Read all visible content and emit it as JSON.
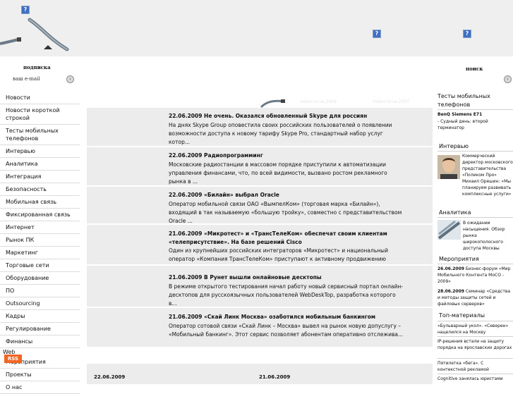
{
  "header": {
    "subscribe_title": "подписка",
    "email_placeholder": "ваш e-mail",
    "search_title": "поиск"
  },
  "nav": {
    "items": [
      {
        "label": "Новости"
      },
      {
        "label": "Новости короткой строкой"
      },
      {
        "label": "Тесты мобильных телефонов"
      },
      {
        "label": "Интервью"
      },
      {
        "label": "Аналитика"
      },
      {
        "label": "Интеграция"
      },
      {
        "label": "Безопасность"
      },
      {
        "label": "Мобильная связь"
      },
      {
        "label": "Фиксированная связь"
      },
      {
        "label": "Интернет"
      },
      {
        "label": "Рынок ПК"
      },
      {
        "label": "Маркетинг"
      },
      {
        "label": "Торговые сети"
      },
      {
        "label": "Оборудование"
      },
      {
        "label": "ПО"
      },
      {
        "label": "Outsourcing"
      },
      {
        "label": "Кадры"
      },
      {
        "label": "Регулирование"
      },
      {
        "label": "Финансы"
      }
    ],
    "web_label": "Web",
    "items2": [
      {
        "label": "Мероприятия"
      },
      {
        "label": "Проекты"
      },
      {
        "label": "О нас"
      }
    ],
    "rss_label": "RSS"
  },
  "news": [
    {
      "title": "22.06.2009 Не очень. Оказался обновленный Skype для россиян",
      "text": "На днях Skype Group оповестила своих российских пользователей о появлении возможности доступа к новому тарифу Skype Pro, стандартный набор услуг котор..."
    },
    {
      "title": "22.06.2009 Радиопрограмминг",
      "text": "Московские радиостанции в массовом порядке приступили к автоматизации управления финансами, что, по всей видимости, вызвано ростом рекламного рынка в ..."
    },
    {
      "title": "22.06.2009 «Билайн» выбрал Oracle",
      "text": "Оператор мобильной связи ОАО «ВымпелКом» (торговая марка «Билайн»), входящий в так называемую «большую тройку», совместно с представительством Oracle ..."
    },
    {
      "title": "21.06.2009 «Микротест» и «ТрансТелеКом» обеспечат своим клиентам «телеприсутствие». На базе решений Cisco",
      "text": "Один из крупнейших российских интеграторов «Микротест» и национальный оператор «Компания ТрансТелеКом» приступают к активному продвижению нового предл..."
    },
    {
      "title": "21.06.2009 В Рунет вышли онлайновые десктопы",
      "text": "В режиме открытого тестирования начал работу новый сервисный портал онлайн-десктопов для русскоязычных пользователей WebDeskTop, разработка которого в..."
    },
    {
      "title": "21.06.2009 «Скай Линк Москва» озаботился мобильным банкингом",
      "text": "Оператор сотовой связи «Скай Линк – Москва» вывел на рынок новую допуслугу – «Мобильный банкинг». Этот сервис позволяет абонентам оперативно отслежива..."
    }
  ],
  "ghost_tabs": [
    "Новости за 2009",
    "Новости за 2007"
  ],
  "date_strip": [
    "22.06.2009",
    "21.06.2009"
  ],
  "right": {
    "tests_title": "Тесты мобильных телефонов",
    "tests_item_bold": "BenQ Siemens E71",
    "tests_item_text": "- Судный день: второй терминатор",
    "interview_title": "Интервью",
    "interview_text": "Коммерческий директор московского представительства «Поликом Про» Михаил Орешин: «Мы планируем развивать комплексные услуги»",
    "analytics_title": "Аналитика",
    "analytics_text": "В ожидании насыщения. Обзор рынка широкополосного доступа Москвы",
    "events_title": "Мероприятия",
    "events": [
      {
        "date": "26.06.2009",
        "text": "Бизнес-форум «Мир Мобильного Контента MoCO - 2009»"
      },
      {
        "date": "28.06.2009",
        "text": "Семинар «Средства и методы защиты сетей и файловых серверов»"
      }
    ],
    "top_title": "Топ-материалы",
    "top": [
      "«Бульварный укол». «Северен» нацелился на Москву",
      "IP-решения встали на защиту порядка на ярославских дорогах",
      "Пятилетка «бега». С контекстной рекламой",
      "Cognitive занялась юристами"
    ]
  }
}
